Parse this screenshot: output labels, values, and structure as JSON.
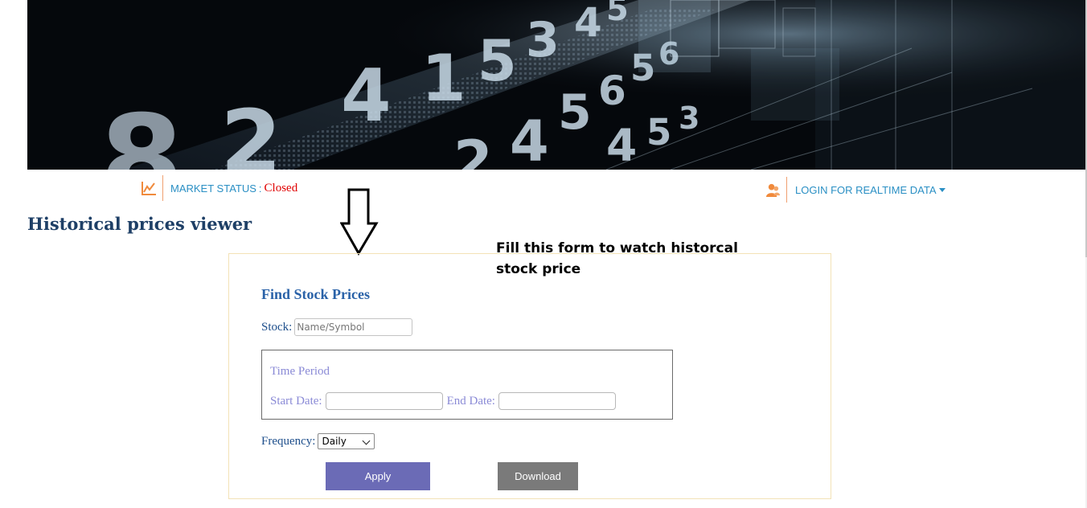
{
  "header": {
    "market_status_label": "MARKET STATUS",
    "market_status_colon": ":",
    "market_status_value": "Closed",
    "login_label": "LOGIN FOR REALTIME DATA"
  },
  "page": {
    "title": "Historical prices viewer"
  },
  "annotation": {
    "text": "Fill this form to watch historcal stock price"
  },
  "form": {
    "title": "Find Stock Prices",
    "stock_label": "Stock:",
    "stock_placeholder": "Name/Symbol",
    "stock_value": "",
    "time_period": {
      "title": "Time Period",
      "start_label": "Start Date:",
      "start_value": "",
      "end_label": "End Date:",
      "end_value": ""
    },
    "frequency_label": "Frequency:",
    "frequency_value": "Daily",
    "apply_label": "Apply",
    "download_label": "Download"
  },
  "icons": {
    "market": "line-chart-icon",
    "login": "user-icon",
    "dropdown": "caret-down-icon",
    "annotation": "arrow-down-icon"
  },
  "colors": {
    "link_blue": "#2a8fc4",
    "status_closed": "#e00000",
    "title_navy": "#1e3f66",
    "apply_button": "#6b6bb6",
    "download_button": "#7a7a7a",
    "icon_orange": "#f08a3c"
  }
}
